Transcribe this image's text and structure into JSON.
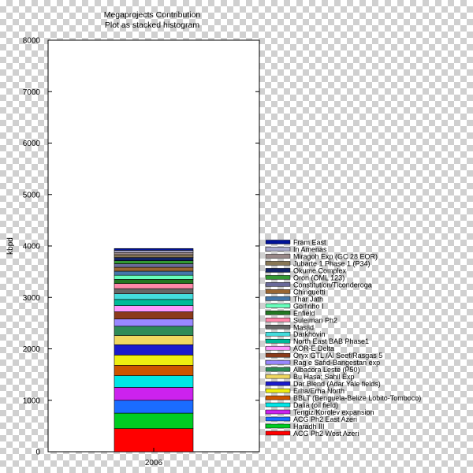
{
  "chart_data": {
    "type": "bar",
    "title": [
      "Megaprojects Contribution",
      "Plot as stacked histogram"
    ],
    "ylabel": "kbpd",
    "xlabel": "",
    "categories": [
      "2006"
    ],
    "ylim": [
      0,
      8000
    ],
    "yticks": [
      0,
      1000,
      2000,
      3000,
      4000,
      5000,
      6000,
      7000,
      8000
    ],
    "legend_position": "right",
    "series": [
      {
        "name": "ACG Ph2 West Azeri",
        "color": "#ff0000",
        "values": [
          450
        ]
      },
      {
        "name": "Haradh III",
        "color": "#00cc22",
        "values": [
          300
        ]
      },
      {
        "name": "ACG Ph2 East Azeri",
        "color": "#1a6cff",
        "values": [
          250
        ]
      },
      {
        "name": "Tengiz/Korolev expansion",
        "color": "#cc22ee",
        "values": [
          250
        ]
      },
      {
        "name": "Dalia (oil field)",
        "color": "#00e6e6",
        "values": [
          230
        ]
      },
      {
        "name": "BBLT (Benguela-Belize Lobito-Tomboco)",
        "color": "#cc5500",
        "values": [
          200
        ]
      },
      {
        "name": "Erha/Erha North",
        "color": "#eeee11",
        "values": [
          200
        ]
      },
      {
        "name": "Dar Blend (Adar Yale fields)",
        "color": "#1a1acc",
        "values": [
          200
        ]
      },
      {
        "name": "Bu Hasa; Sahil Exp",
        "color": "#f0d860",
        "values": [
          180
        ]
      },
      {
        "name": "Albacora Leste (P50)",
        "color": "#2e8b57",
        "values": [
          180
        ]
      },
      {
        "name": "Rag e Safid-Bangestan exp",
        "color": "#9988ff",
        "values": [
          140
        ]
      },
      {
        "name": "Oryx GTL /Al Seef/Rasgas 5",
        "color": "#8b3a1a",
        "values": [
          140
        ]
      },
      {
        "name": "AOR-E Delta",
        "color": "#ff99ff",
        "values": [
          120
        ]
      },
      {
        "name": "North East BAB Phase1",
        "color": "#00bb99",
        "values": [
          120
        ]
      },
      {
        "name": "Darkhovin",
        "color": "#44dddd",
        "values": [
          110
        ]
      },
      {
        "name": "Masjid",
        "color": "#666666",
        "values": [
          100
        ]
      },
      {
        "name": "Suleiman Ph2",
        "color": "#ff88aa",
        "values": [
          100
        ]
      },
      {
        "name": "Enfield",
        "color": "#227722",
        "values": [
          80
        ]
      },
      {
        "name": "Golfinho I",
        "color": "#66ffbb",
        "values": [
          80
        ]
      },
      {
        "name": "Thar Jath",
        "color": "#4477aa",
        "values": [
          80
        ]
      },
      {
        "name": "Chinguetti",
        "color": "#996633",
        "values": [
          75
        ]
      },
      {
        "name": "Constitution/Ticonderoga",
        "color": "#6a6a9a",
        "values": [
          70
        ]
      },
      {
        "name": "Oron (OML 123)",
        "color": "#339933",
        "values": [
          60
        ]
      },
      {
        "name": "Okume Complex",
        "color": "#112266",
        "values": [
          60
        ]
      },
      {
        "name": "Jubarte 1 Phase 1 (P34)",
        "color": "#887755",
        "values": [
          55
        ]
      },
      {
        "name": "Miragoh Exp (GC 28 EOR)",
        "color": "#998888",
        "values": [
          45
        ]
      },
      {
        "name": "In Amenas",
        "color": "#aaaacc",
        "values": [
          40
        ]
      },
      {
        "name": "Fram East",
        "color": "#001199",
        "values": [
          35
        ]
      }
    ]
  }
}
